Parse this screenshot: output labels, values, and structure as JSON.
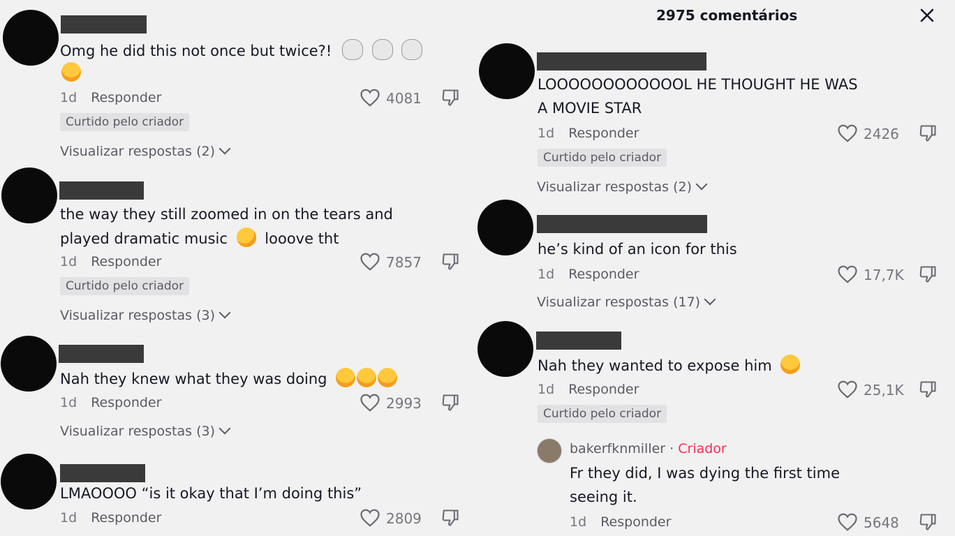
{
  "header": {
    "title": "2975 comentários",
    "close_icon": "close-icon"
  },
  "labels": {
    "reply": "Responder",
    "liked_by_creator": "Curtido pelo criador",
    "creator_tag": "Criador"
  },
  "left_comments": [
    {
      "text1": "Omg he did this not once but twice?!",
      "time": "1d",
      "likes": "4081",
      "view_replies": "Visualizar respostas (2)"
    },
    {
      "text1": "the way they still zoomed in on the tears and",
      "text2": "played dramatic music",
      "text2b": "looove tht",
      "time": "1d",
      "likes": "7857",
      "view_replies": "Visualizar respostas (3)"
    },
    {
      "text1": "Nah they knew what they was doing",
      "time": "1d",
      "likes": "2993",
      "view_replies": "Visualizar respostas (3)"
    },
    {
      "text1": "LMAOOOO “is it okay that I’m doing this”",
      "time": "1d",
      "likes": "2809"
    }
  ],
  "right_comments": [
    {
      "text1": "LOOOOOOOOOOOOL HE THOUGHT HE WAS",
      "text2": "A MOVIE STAR",
      "time": "1d",
      "likes": "2426",
      "view_replies": "Visualizar respostas (2)"
    },
    {
      "text1": "he’s kind of an icon for this",
      "time": "1d",
      "likes": "17,7K",
      "view_replies": "Visualizar respostas (17)"
    },
    {
      "text1": "Nah they wanted to expose him",
      "time": "1d",
      "likes": "25,1K"
    }
  ],
  "creator_reply": {
    "username": "bakerfknmiller",
    "separator": " · ",
    "text1": "Fr they did, I was dying the first time",
    "text2": "seeing it.",
    "time": "1d",
    "likes": "5648"
  }
}
